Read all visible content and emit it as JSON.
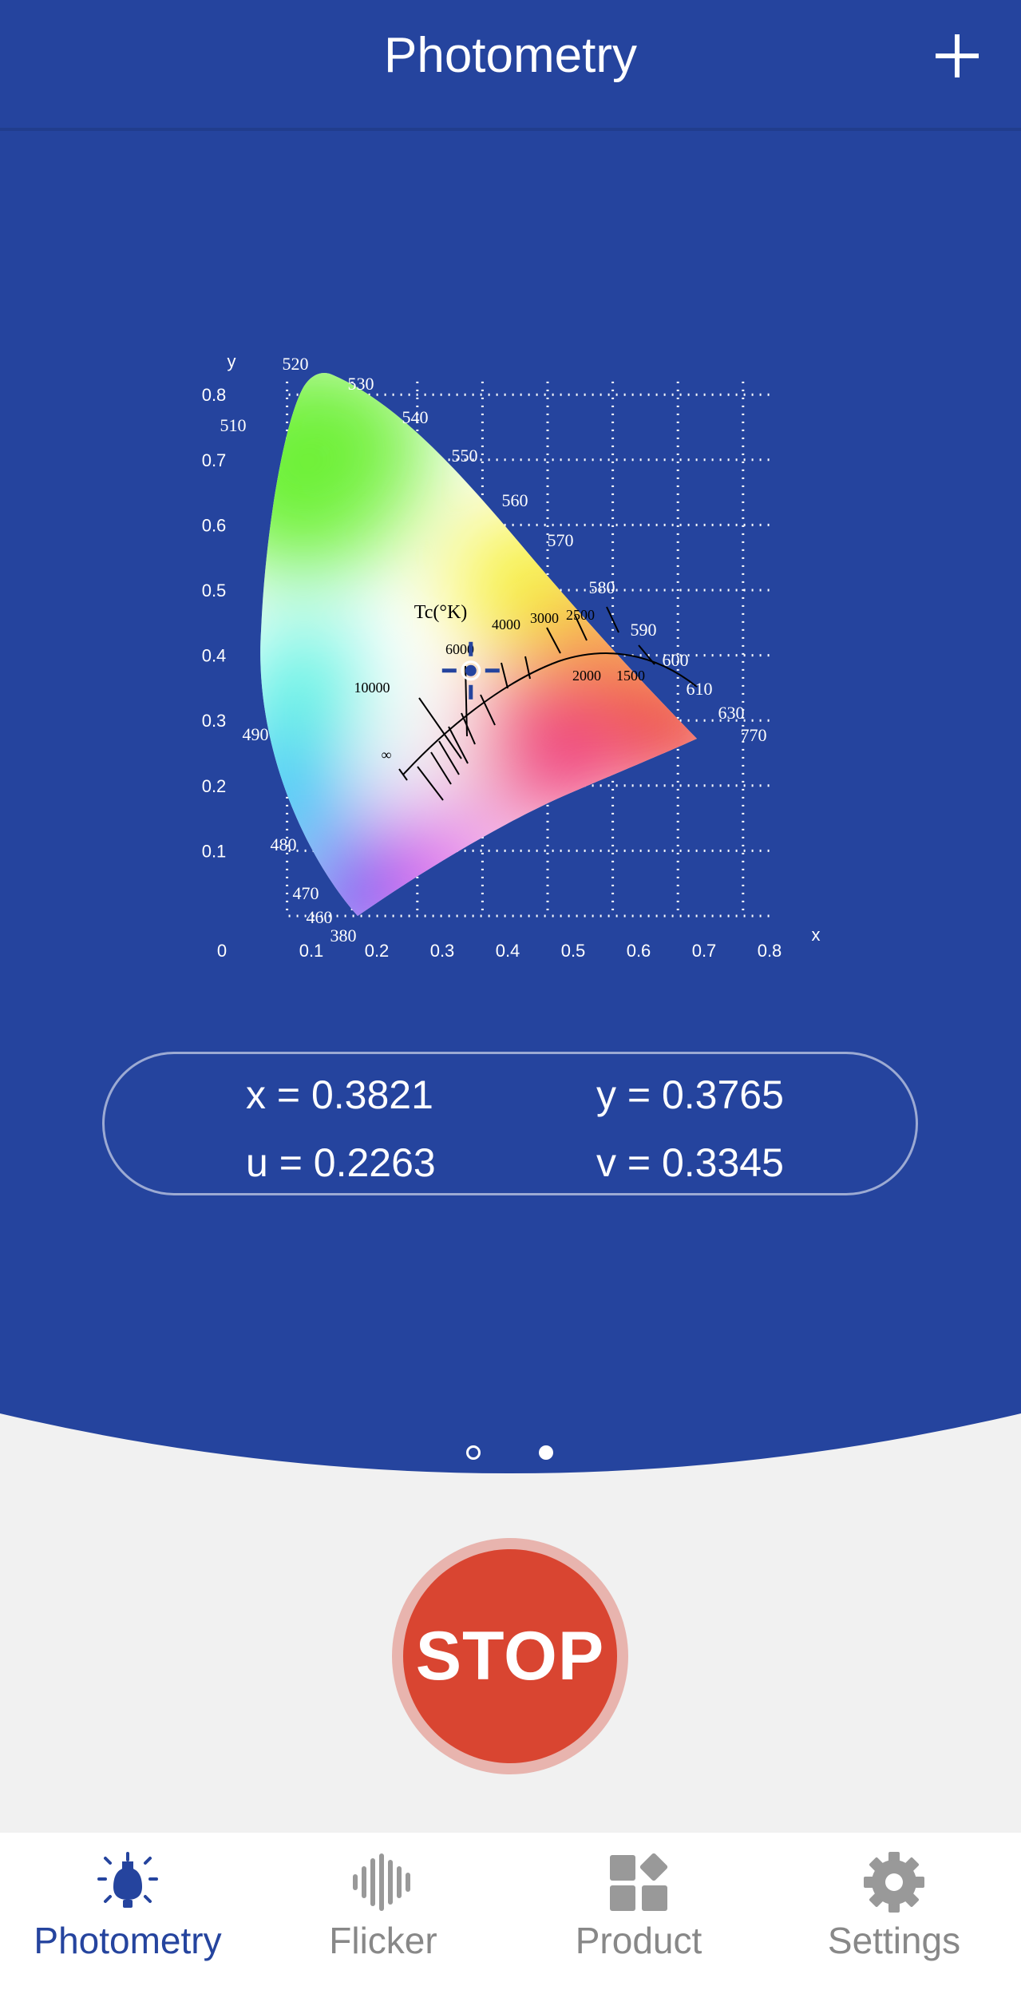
{
  "header": {
    "title": "Photometry",
    "add_icon": "plus-icon"
  },
  "colors": {
    "primary": "#25449e",
    "background": "#f1f1f1",
    "stop": "#d94531",
    "stop_ring": "#e8b4ae",
    "inactive": "#888888"
  },
  "cie_chart": {
    "x_axis_label": "x",
    "y_axis_label": "y",
    "x_ticks": [
      "0",
      "0.1",
      "0.2",
      "0.3",
      "0.4",
      "0.5",
      "0.6",
      "0.7",
      "0.8"
    ],
    "y_ticks": [
      "0.1",
      "0.2",
      "0.3",
      "0.4",
      "0.5",
      "0.6",
      "0.7",
      "0.8"
    ],
    "wavelength_labels": [
      "520",
      "530",
      "540",
      "550",
      "560",
      "570",
      "580",
      "590",
      "600",
      "610",
      "630",
      "770",
      "510",
      "490",
      "480",
      "470",
      "460",
      "380"
    ],
    "cct_title": "Tc(°K)",
    "cct_labels": [
      "∞",
      "10000",
      "6000",
      "4000",
      "3000",
      "2500",
      "2000",
      "1500"
    ]
  },
  "chart_data": {
    "type": "scatter",
    "title": "",
    "xlabel": "x",
    "ylabel": "y",
    "xlim": [
      0,
      0.8
    ],
    "ylim": [
      0,
      0.8
    ],
    "series": [
      {
        "x": [
          0.3821
        ],
        "y": [
          0.3765
        ]
      }
    ]
  },
  "readout": {
    "x": "x = 0.3821",
    "y": "y = 0.3765",
    "u": "u = 0.2263",
    "v": "v = 0.3345"
  },
  "pager": {
    "pages": 2,
    "active_page": 2
  },
  "stop_button": {
    "label": "STOP"
  },
  "tabs": [
    {
      "label": "Photometry",
      "icon": "bulb-icon",
      "active": true
    },
    {
      "label": "Flicker",
      "icon": "waveform-icon",
      "active": false
    },
    {
      "label": "Product",
      "icon": "grid-icon",
      "active": false
    },
    {
      "label": "Settings",
      "icon": "gear-icon",
      "active": false
    }
  ]
}
